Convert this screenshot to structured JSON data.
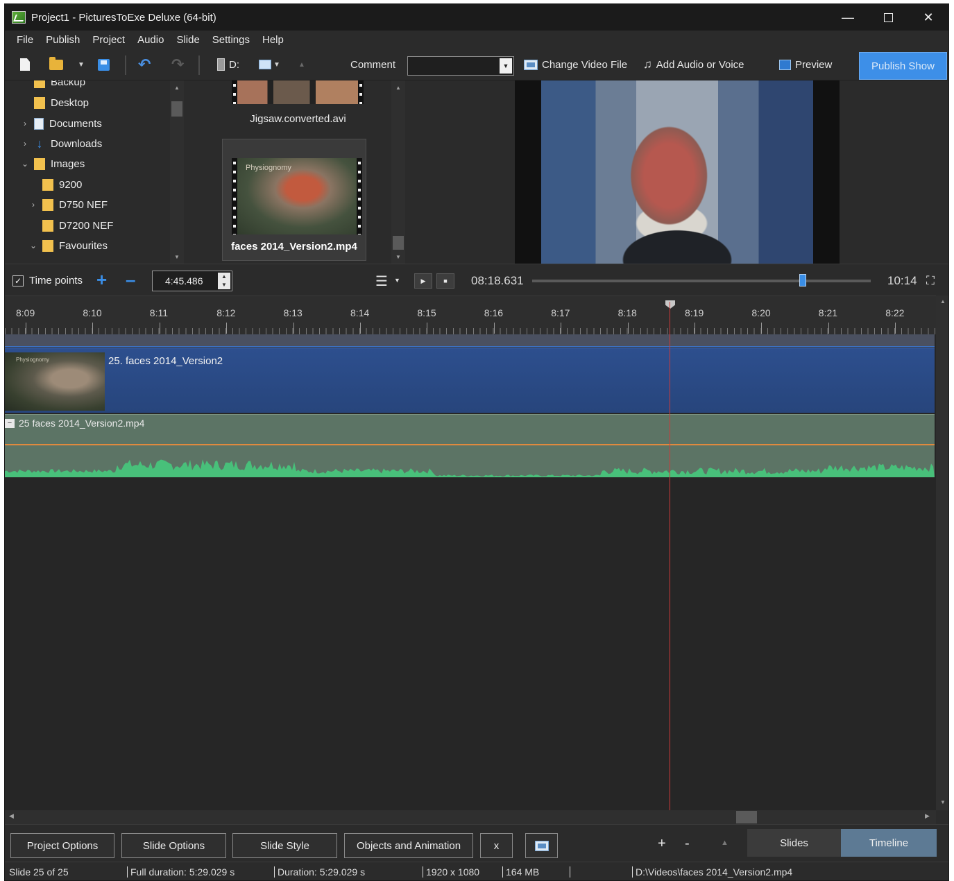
{
  "window": {
    "title": "Project1 - PicturesToExe Deluxe (64-bit)",
    "controls": {
      "minimize": "—",
      "close": "✕"
    }
  },
  "menu": [
    "File",
    "Publish",
    "Project",
    "Audio",
    "Slide",
    "Settings",
    "Help"
  ],
  "toolbar": {
    "drive": "D:",
    "comment_label": "Comment",
    "comment_value": "",
    "change_video": "Change Video File",
    "add_audio": "Add Audio or Voice",
    "preview": "Preview",
    "publish": "Publish Show"
  },
  "folder_tree": [
    {
      "label": "Backup",
      "chevron": "",
      "icon": "folder"
    },
    {
      "label": "Desktop",
      "chevron": "",
      "icon": "folder"
    },
    {
      "label": "Documents",
      "chevron": "›",
      "icon": "documents"
    },
    {
      "label": "Downloads",
      "chevron": "›",
      "icon": "download-arrow"
    },
    {
      "label": "Images",
      "chevron": "⌄",
      "icon": "folder"
    },
    {
      "label": "9200",
      "chevron": "",
      "icon": "folder"
    },
    {
      "label": "D750 NEF",
      "chevron": "›",
      "icon": "folder"
    },
    {
      "label": "D7200 NEF",
      "chevron": "",
      "icon": "folder"
    },
    {
      "label": "Favourites",
      "chevron": "⌄",
      "icon": "folder"
    }
  ],
  "files": [
    {
      "name": "Jigsaw.converted.avi"
    },
    {
      "name": "faces 2014_Version2.mp4",
      "thumb_title": "Physiognomy",
      "selected": true
    }
  ],
  "transport": {
    "timepoints_label": "Time points",
    "timepoints_checked": "✓",
    "time_value": "4:45.486",
    "current_time": "08:18.631",
    "end_time": "10:14",
    "position_fraction": 0.8
  },
  "ruler": {
    "labels": [
      "8:09",
      "8:10",
      "8:11",
      "8:12",
      "8:13",
      "8:14",
      "8:15",
      "8:16",
      "8:17",
      "8:18",
      "8:19",
      "8:20",
      "8:21",
      "8:22"
    ]
  },
  "tracks": {
    "video_label": "25. faces 2014_Version2",
    "video_thumb_text": "Physiognomy",
    "audio_label": "25  faces 2014_Version2.mp4"
  },
  "bottom_buttons": {
    "project_options": "Project Options",
    "slide_options": "Slide Options",
    "slide_style": "Slide Style",
    "objects_animation": "Objects and Animation",
    "close": "x",
    "plus": "+",
    "minus": "-"
  },
  "view_tabs": {
    "slides": "Slides",
    "timeline": "Timeline",
    "active": "Timeline"
  },
  "status": {
    "slide": "Slide 25 of 25",
    "full_duration": "Full duration: 5:29.029 s",
    "duration": "Duration: 5:29.029 s",
    "resolution": "1920 x 1080",
    "size": "164 MB",
    "path": "D:\\Videos\\faces 2014_Version2.mp4"
  },
  "colors": {
    "accent": "#3a8ee6",
    "video_track": "#2d4f8e",
    "audio_track": "#5c7465",
    "waveform": "#48c07a",
    "playhead": "#d03a3a",
    "active_tab": "#5d7a94"
  }
}
